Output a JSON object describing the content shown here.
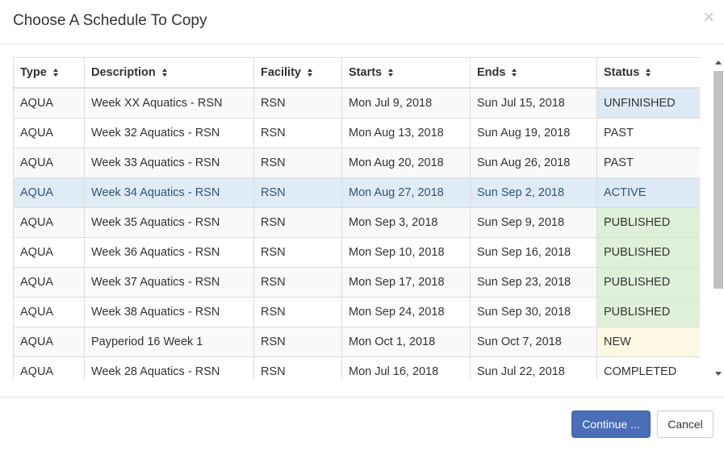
{
  "modal": {
    "title": "Choose A Schedule To Copy",
    "close_glyph": "×"
  },
  "table": {
    "headers": [
      "Type",
      "Description",
      "Facility",
      "Starts",
      "Ends",
      "Status"
    ],
    "rows": [
      {
        "type": "AQUA",
        "description": "Week XX Aquatics - RSN",
        "facility": "RSN",
        "starts": "Mon Jul 9, 2018",
        "ends": "Sun Jul 15, 2018",
        "status": "UNFINISHED"
      },
      {
        "type": "AQUA",
        "description": "Week 32 Aquatics - RSN",
        "facility": "RSN",
        "starts": "Mon Aug 13, 2018",
        "ends": "Sun Aug 19, 2018",
        "status": "PAST"
      },
      {
        "type": "AQUA",
        "description": "Week 33 Aquatics - RSN",
        "facility": "RSN",
        "starts": "Mon Aug 20, 2018",
        "ends": "Sun Aug 26, 2018",
        "status": "PAST"
      },
      {
        "type": "AQUA",
        "description": "Week 34 Aquatics - RSN",
        "facility": "RSN",
        "starts": "Mon Aug 27, 2018",
        "ends": "Sun Sep 2, 2018",
        "status": "ACTIVE"
      },
      {
        "type": "AQUA",
        "description": "Week 35 Aquatics - RSN",
        "facility": "RSN",
        "starts": "Mon Sep 3, 2018",
        "ends": "Sun Sep 9, 2018",
        "status": "PUBLISHED"
      },
      {
        "type": "AQUA",
        "description": "Week 36 Aquatics - RSN",
        "facility": "RSN",
        "starts": "Mon Sep 10, 2018",
        "ends": "Sun Sep 16, 2018",
        "status": "PUBLISHED"
      },
      {
        "type": "AQUA",
        "description": "Week 37 Aquatics - RSN",
        "facility": "RSN",
        "starts": "Mon Sep 17, 2018",
        "ends": "Sun Sep 23, 2018",
        "status": "PUBLISHED"
      },
      {
        "type": "AQUA",
        "description": "Week 38 Aquatics - RSN",
        "facility": "RSN",
        "starts": "Mon Sep 24, 2018",
        "ends": "Sun Sep 30, 2018",
        "status": "PUBLISHED"
      },
      {
        "type": "AQUA",
        "description": "Payperiod 16 Week 1",
        "facility": "RSN",
        "starts": "Mon Oct 1, 2018",
        "ends": "Sun Oct 7, 2018",
        "status": "NEW"
      },
      {
        "type": "AQUA",
        "description": "Week 28 Aquatics - RSN",
        "facility": "RSN",
        "starts": "Mon Jul 16, 2018",
        "ends": "Sun Jul 22, 2018",
        "status": "COMPLETED"
      }
    ]
  },
  "footer": {
    "continue_label": "Continue ...",
    "cancel_label": "Cancel"
  },
  "colors": {
    "primary_button": "#4a6eb8",
    "active_row": "#dfebf5",
    "published": "#dff0d8",
    "new": "#fcf8e3"
  }
}
